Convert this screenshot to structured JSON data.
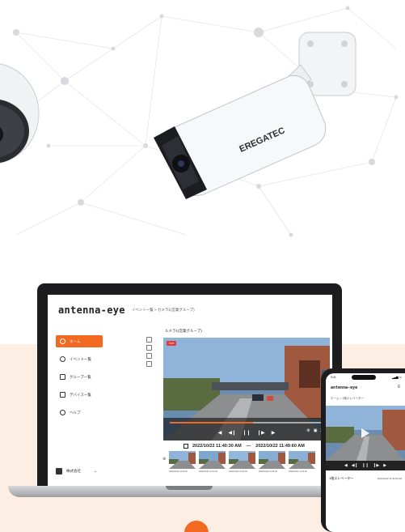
{
  "colors": {
    "accent": "#f26a21",
    "dark": "#1d1d1f",
    "peach": "#fdeee3",
    "live": "#e53935"
  },
  "camera": {
    "brand_print": "EREGATEC"
  },
  "app": {
    "brand": "antenna-eye",
    "breadcrumb": "イベント一覧 > カメラ1(営業グループ)",
    "group_title": "ルメラ1(営業グループ)"
  },
  "sidebar": {
    "items": [
      {
        "label": "ホーム",
        "icon": "home-icon",
        "active": true
      },
      {
        "label": "イベント一覧",
        "icon": "event-icon",
        "active": false
      },
      {
        "label": "グループ一覧",
        "icon": "group-icon",
        "active": false
      },
      {
        "label": "デバイス一覧",
        "icon": "device-icon",
        "active": false
      },
      {
        "label": "ヘルプ",
        "icon": "help-icon",
        "active": false
      }
    ],
    "org_label": "株式会社"
  },
  "player": {
    "live_label": "Live",
    "progress": 0.55,
    "range_start": "2022/10/22 11:40:30 AM",
    "range_sep": "—",
    "range_end": "2022/10/22 11:49:60 AM"
  },
  "thumbnails": [
    {
      "label": "2022/10/22 11:40:30"
    },
    {
      "label": "2022/10/22 11:41:30"
    },
    {
      "label": "2022/10/22 11:42:30"
    },
    {
      "label": "2022/10/22 11:43:30"
    },
    {
      "label": "2022/10/22 11:44:30"
    }
  ],
  "phone": {
    "time": "9:41",
    "brand": "antenna-eye",
    "breadcrumb": "ホーム > 1階エレベーター",
    "row_title": "1階エレベーター",
    "row_time": "2022/10/22 11:49:60 AM"
  }
}
